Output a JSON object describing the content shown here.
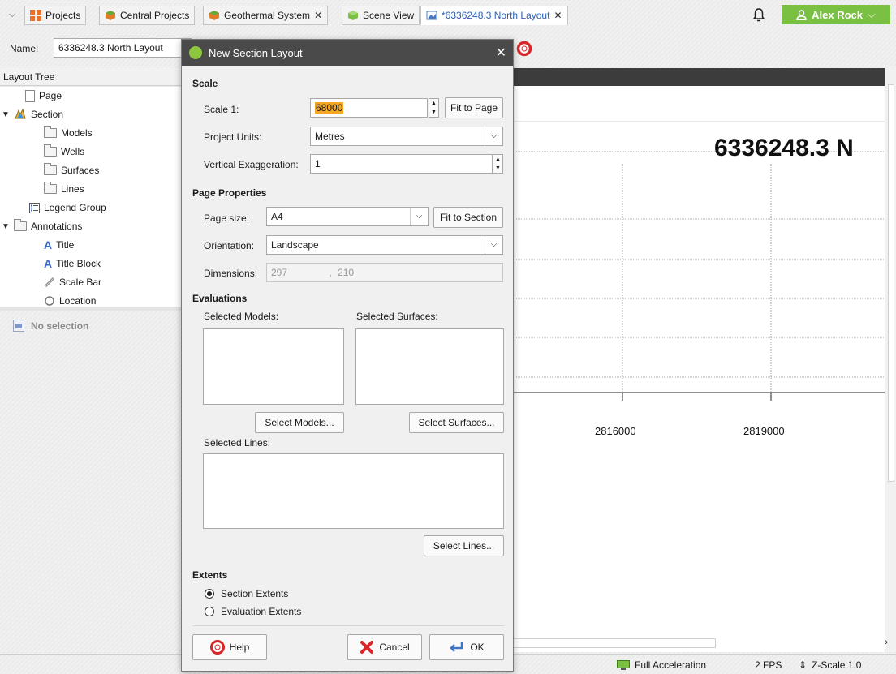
{
  "tabs": {
    "items": [
      {
        "label": "Projects",
        "closable": false
      },
      {
        "label": "Central Projects",
        "closable": false
      },
      {
        "label": "Geothermal System",
        "closable": true
      },
      {
        "label": "Scene View",
        "closable": false
      },
      {
        "label": "*6336248.3 North Layout",
        "closable": true,
        "active": true
      }
    ],
    "close_glyph": "✕",
    "dropdown_glyph": "⌵"
  },
  "user": {
    "name": "Alex Rock",
    "accent": "#7ac143"
  },
  "name_row": {
    "label": "Name:",
    "value": "6336248.3 North Layout"
  },
  "layout_tree": {
    "header": "Layout Tree",
    "items": [
      {
        "label": "Page",
        "icon": "page-icon",
        "level": 1
      },
      {
        "label": "Section",
        "icon": "section-icon",
        "level": 0
      },
      {
        "label": "Models",
        "icon": "folder-icon",
        "level": 2
      },
      {
        "label": "Wells",
        "icon": "folder-icon",
        "level": 2
      },
      {
        "label": "Surfaces",
        "icon": "folder-icon",
        "level": 2
      },
      {
        "label": "Lines",
        "icon": "folder-icon",
        "level": 2
      },
      {
        "label": "Legend Group",
        "icon": "legend-icon",
        "level": 1
      },
      {
        "label": "Annotations",
        "icon": "folder-icon",
        "level": 0
      },
      {
        "label": "Title",
        "icon": "text-a-icon",
        "level": 2
      },
      {
        "label": "Title Block",
        "icon": "text-a-icon",
        "level": 2
      },
      {
        "label": "Scale Bar",
        "icon": "ruler-icon",
        "level": 2
      },
      {
        "label": "Location",
        "icon": "location-icon",
        "level": 2
      }
    ]
  },
  "selection_panel": {
    "text": "No selection"
  },
  "dialog": {
    "title": "New Section Layout",
    "scale": {
      "section": "Scale",
      "scale_label": "Scale 1:",
      "scale_value": "68000",
      "fit_to_page": "Fit to Page",
      "units_label": "Project Units:",
      "units_value": "Metres",
      "vexag_label": "Vertical Exaggeration:",
      "vexag_value": "1"
    },
    "page": {
      "section": "Page Properties",
      "size_label": "Page size:",
      "size_value": "A4",
      "fit_to_section": "Fit to Section",
      "orient_label": "Orientation:",
      "orient_value": "Landscape",
      "dims_label": "Dimensions:",
      "dim_w": "297",
      "dim_sep": ",",
      "dim_h": "210"
    },
    "evaluations": {
      "section": "Evaluations",
      "models_label": "Selected Models:",
      "surfaces_label": "Selected Surfaces:",
      "select_models": "Select Models...",
      "select_surfaces": "Select Surfaces...",
      "lines_label": "Selected Lines:",
      "select_lines": "Select Lines..."
    },
    "extents": {
      "section": "Extents",
      "section_extents": "Section Extents",
      "evaluation_extents": "Evaluation Extents",
      "selected": "section"
    },
    "buttons": {
      "help": "Help",
      "cancel": "Cancel",
      "ok": "OK"
    }
  },
  "scene": {
    "title": "6336248.3 N",
    "x_ticks": [
      "2816000",
      "2819000"
    ]
  },
  "status": {
    "acceleration": "Full Acceleration",
    "fps": "2 FPS",
    "zscale": "Z-Scale 1.0"
  }
}
